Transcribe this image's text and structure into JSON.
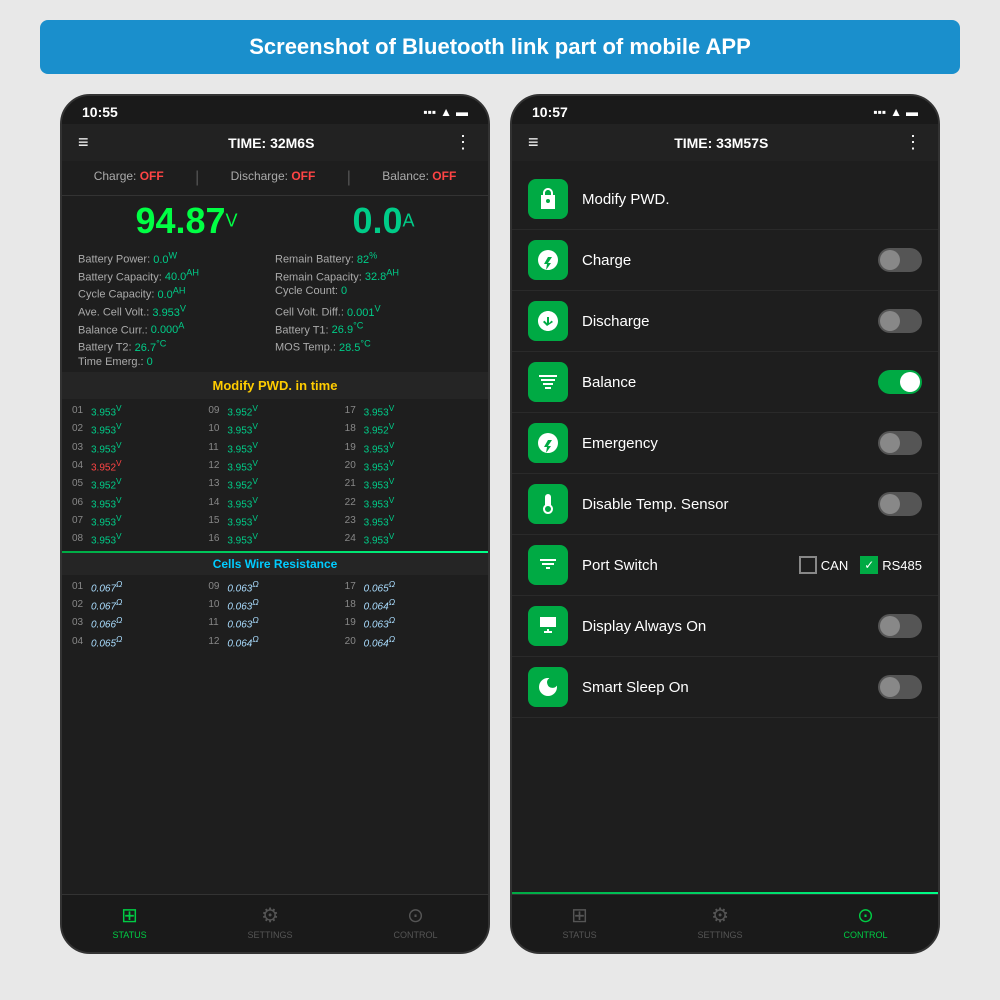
{
  "page": {
    "bg_color": "#e8e8e8",
    "header": "Screenshot of Bluetooth link part of mobile APP"
  },
  "left_phone": {
    "status_bar": {
      "time": "10:55",
      "signal": "▪▪▪",
      "wifi": "WiFi",
      "battery": "🔋"
    },
    "app_header": {
      "menu": "≡",
      "title": "TIME: 32M6S",
      "more": "⋮"
    },
    "charge_bar": {
      "charge": "Charge:",
      "charge_val": "OFF",
      "discharge": "Discharge:",
      "discharge_val": "OFF",
      "balance": "Balance:",
      "balance_val": "OFF"
    },
    "voltage": "94.87",
    "voltage_unit": "V",
    "current": "0.0",
    "current_unit": "A",
    "stats": [
      {
        "label": "Battery Power:",
        "val": "0.0",
        "unit": "W"
      },
      {
        "label": "Remain Battery:",
        "val": "82",
        "unit": "%"
      },
      {
        "label": "Battery Capacity:",
        "val": "40.0",
        "unit": "AH"
      },
      {
        "label": "Remain Capacity:",
        "val": "32.8",
        "unit": "AH"
      },
      {
        "label": "Cycle Capacity:",
        "val": "0.0",
        "unit": "AH"
      },
      {
        "label": "Cycle Count:",
        "val": "0",
        "unit": ""
      },
      {
        "label": "Ave. Cell Volt.:",
        "val": "3.953",
        "unit": "V"
      },
      {
        "label": "Cell Volt. Diff.:",
        "val": "0.001",
        "unit": "V"
      },
      {
        "label": "Balance Curr.:",
        "val": "0.000",
        "unit": "A"
      },
      {
        "label": "Battery T1:",
        "val": "26.9",
        "unit": "°C"
      },
      {
        "label": "Battery T2:",
        "val": "26.7",
        "unit": "°C"
      },
      {
        "label": "MOS Temp.:",
        "val": "28.5",
        "unit": "°C"
      },
      {
        "label": "Time Emerg.:",
        "val": "0",
        "unit": ""
      }
    ],
    "modify_banner": "Modify PWD. in time",
    "cells": [
      {
        "num": "01",
        "val": "3.953",
        "red": false
      },
      {
        "num": "09",
        "val": "3.952",
        "red": false
      },
      {
        "num": "17",
        "val": "3.953",
        "red": false
      },
      {
        "num": "02",
        "val": "3.953",
        "red": false
      },
      {
        "num": "10",
        "val": "3.953",
        "red": false
      },
      {
        "num": "18",
        "val": "3.952",
        "red": false
      },
      {
        "num": "03",
        "val": "3.953",
        "red": false
      },
      {
        "num": "11",
        "val": "3.953",
        "red": false
      },
      {
        "num": "19",
        "val": "3.953",
        "red": false
      },
      {
        "num": "04",
        "val": "3.952",
        "red": true
      },
      {
        "num": "12",
        "val": "3.953",
        "red": false
      },
      {
        "num": "20",
        "val": "3.953",
        "red": false
      },
      {
        "num": "05",
        "val": "3.952",
        "red": false
      },
      {
        "num": "13",
        "val": "3.952",
        "red": false
      },
      {
        "num": "21",
        "val": "3.953",
        "red": false
      },
      {
        "num": "06",
        "val": "3.953",
        "red": false
      },
      {
        "num": "14",
        "val": "3.953",
        "red": false
      },
      {
        "num": "22",
        "val": "3.953",
        "red": false
      },
      {
        "num": "07",
        "val": "3.953",
        "red": false
      },
      {
        "num": "15",
        "val": "3.953",
        "red": false
      },
      {
        "num": "23",
        "val": "3.953",
        "red": false
      },
      {
        "num": "08",
        "val": "3.953",
        "red": false
      },
      {
        "num": "16",
        "val": "3.953",
        "red": false
      },
      {
        "num": "24",
        "val": "3.953",
        "red": false
      }
    ],
    "resistance_title": "Cells Wire Resistance",
    "resistances": [
      {
        "num": "01",
        "val": "0.067"
      },
      {
        "num": "09",
        "val": "0.063"
      },
      {
        "num": "17",
        "val": "0.065"
      },
      {
        "num": "02",
        "val": "0.067"
      },
      {
        "num": "10",
        "val": "0.063"
      },
      {
        "num": "18",
        "val": "0.064"
      },
      {
        "num": "03",
        "val": "0.066"
      },
      {
        "num": "11",
        "val": "0.063"
      },
      {
        "num": "19",
        "val": "0.063"
      },
      {
        "num": "04",
        "val": "0.065"
      },
      {
        "num": "12",
        "val": "0.064"
      },
      {
        "num": "20",
        "val": "0.064"
      }
    ],
    "nav": [
      {
        "icon": "＋",
        "label": "STATUS",
        "active": true
      },
      {
        "icon": "⚙",
        "label": "SETTINGS",
        "active": false
      },
      {
        "icon": "⊙",
        "label": "CONTROL",
        "active": false
      }
    ]
  },
  "right_phone": {
    "status_bar": {
      "time": "10:57"
    },
    "app_header": {
      "menu": "≡",
      "title": "TIME: 33M57S",
      "more": "⋮"
    },
    "controls": [
      {
        "label": "Modify PWD.",
        "toggle": null,
        "on": false,
        "icon_type": "lock"
      },
      {
        "label": "Charge",
        "toggle": true,
        "on": false,
        "icon_type": "charge"
      },
      {
        "label": "Discharge",
        "toggle": true,
        "on": false,
        "icon_type": "discharge"
      },
      {
        "label": "Balance",
        "toggle": true,
        "on": true,
        "icon_type": "balance"
      },
      {
        "label": "Emergency",
        "toggle": true,
        "on": false,
        "icon_type": "emergency"
      },
      {
        "label": "Disable Temp. Sensor",
        "toggle": true,
        "on": false,
        "icon_type": "temp"
      },
      {
        "label": "Port Switch",
        "toggle": null,
        "on": false,
        "icon_type": "port"
      },
      {
        "label": "Display Always On",
        "toggle": true,
        "on": false,
        "icon_type": "display"
      },
      {
        "label": "Smart Sleep On",
        "toggle": true,
        "on": false,
        "icon_type": "sleep"
      }
    ],
    "port_options": [
      {
        "label": "CAN",
        "checked": false
      },
      {
        "label": "RS485",
        "checked": true
      }
    ],
    "nav": [
      {
        "icon": "＋",
        "label": "STATUS",
        "active": false
      },
      {
        "icon": "⚙",
        "label": "SETTINGS",
        "active": false
      },
      {
        "icon": "⊙",
        "label": "CONTROL",
        "active": true
      }
    ]
  }
}
